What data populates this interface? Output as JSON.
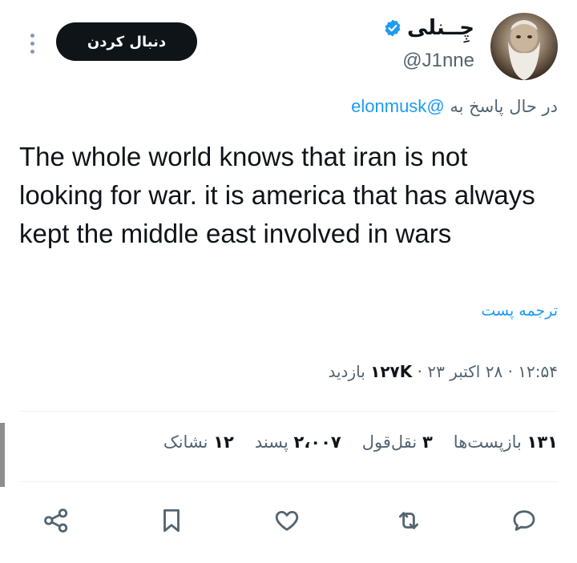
{
  "header": {
    "more_label": "⋮",
    "follow_label": "دنبال کردن",
    "display_name": "چِــنلی",
    "handle": "@J1nne",
    "avatar_icon": "avatar-photo"
  },
  "reply": {
    "prefix": "در حال پاسخ به",
    "mention": "@elonmusk"
  },
  "tweet": {
    "text": "The whole world knows that iran is not looking for war. it is america that has always kept the middle east involved in wars",
    "translate_label": "ترجمه پست"
  },
  "meta": {
    "time": "۱۲:۵۴",
    "date": "۲۸ اکتبر ۲۳",
    "views_count": "۱۲۷K",
    "views_label": "بازدید",
    "separator": "·"
  },
  "stats": {
    "reposts_count": "۱۳۱",
    "reposts_label": "بازپست‌ها",
    "quotes_count": "۳",
    "quotes_label": "نقل‌قول",
    "likes_count": "۲،۰۰۷",
    "likes_label": "پسند",
    "bookmarks_count": "۱۲",
    "bookmarks_label": "نشانک"
  },
  "actions": [
    "share-icon",
    "bookmark-icon",
    "like-icon",
    "repost-icon",
    "reply-icon"
  ],
  "colors": {
    "accent": "#1d9bf0",
    "text": "#0f1419",
    "muted": "#536471",
    "button": "#0f1419"
  }
}
